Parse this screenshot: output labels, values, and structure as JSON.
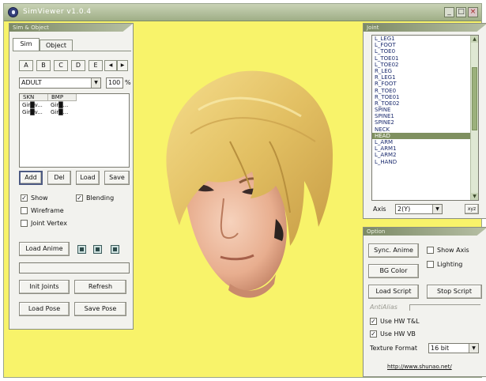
{
  "window": {
    "title": "SimViewer v1.0.4",
    "controls": [
      "minimize-icon",
      "maximize-icon",
      "close-icon"
    ]
  },
  "sim_panel": {
    "header": "Sim & Object",
    "tabs": [
      "Sim",
      "Object"
    ],
    "letter_tabs": [
      "A",
      "B",
      "C",
      "D",
      "E"
    ],
    "age_select": "ADULT",
    "size_value": "100",
    "size_unit": "%",
    "skin_columns": [
      "SKN",
      "BMP"
    ],
    "skin_rows": [
      [
        "Gir█v...",
        "Gir█..."
      ],
      [
        "Gir█v...",
        "Gir█..."
      ]
    ],
    "buttons": {
      "add": "Add",
      "del": "Del",
      "load": "Load",
      "save": "Save"
    },
    "checks": {
      "show": {
        "label": "Show",
        "checked": true
      },
      "blending": {
        "label": "Blending",
        "checked": true
      },
      "wireframe": {
        "label": "Wireframe",
        "checked": false
      },
      "joint_vertex": {
        "label": "Joint Vertex",
        "checked": false
      }
    },
    "load_anime": "Load Anime",
    "anim_controls": [
      "play-icon",
      "stop-icon",
      "step-icon"
    ],
    "init_joints": "Init Joints",
    "refresh": "Refresh",
    "load_pose": "Load Pose",
    "save_pose": "Save Pose"
  },
  "joint_panel": {
    "header": "Joint",
    "items": [
      "L_LEG1",
      "L_FOOT",
      "L_TOE0",
      "L_TOE01",
      "L_TOE02",
      "R_LEG",
      "R_LEG1",
      "R_FOOT",
      "R_TOE0",
      "R_TOE01",
      "R_TOE02",
      "SPINE",
      "SPINE1",
      "SPINE2",
      "NECK",
      "HEAD",
      "L_ARM",
      "L_ARM1",
      "L_ARM2",
      "L_HAND"
    ],
    "selected": "HEAD",
    "axis_label": "Axis",
    "axis_value": "2(Y)",
    "reset_button": "xyz"
  },
  "option_panel": {
    "header": "Option",
    "sync_anime": "Sync. Anime",
    "show_axis": {
      "label": "Show Axis",
      "checked": false
    },
    "bg_color": "BG Color",
    "lighting": {
      "label": "Lighting",
      "checked": false
    },
    "load_script": "Load Script",
    "stop_script": "Stop Script",
    "ani_alias_label": "AntiAlias",
    "use_hw_tnl": {
      "label": "Use HW T&L",
      "checked": true
    },
    "use_hw_vb": {
      "label": "Use HW VB",
      "checked": true
    },
    "texture_format_label": "Texture Format",
    "texture_format_value": "16 bit",
    "url": "http://www.shunao.net/"
  },
  "colors": {
    "viewport_bg": "#f8f36a",
    "panel_header": "#7c8a66",
    "selected_joint": "#7f9060",
    "hair": "#e6c46a",
    "skin": "#f0c2a6"
  }
}
